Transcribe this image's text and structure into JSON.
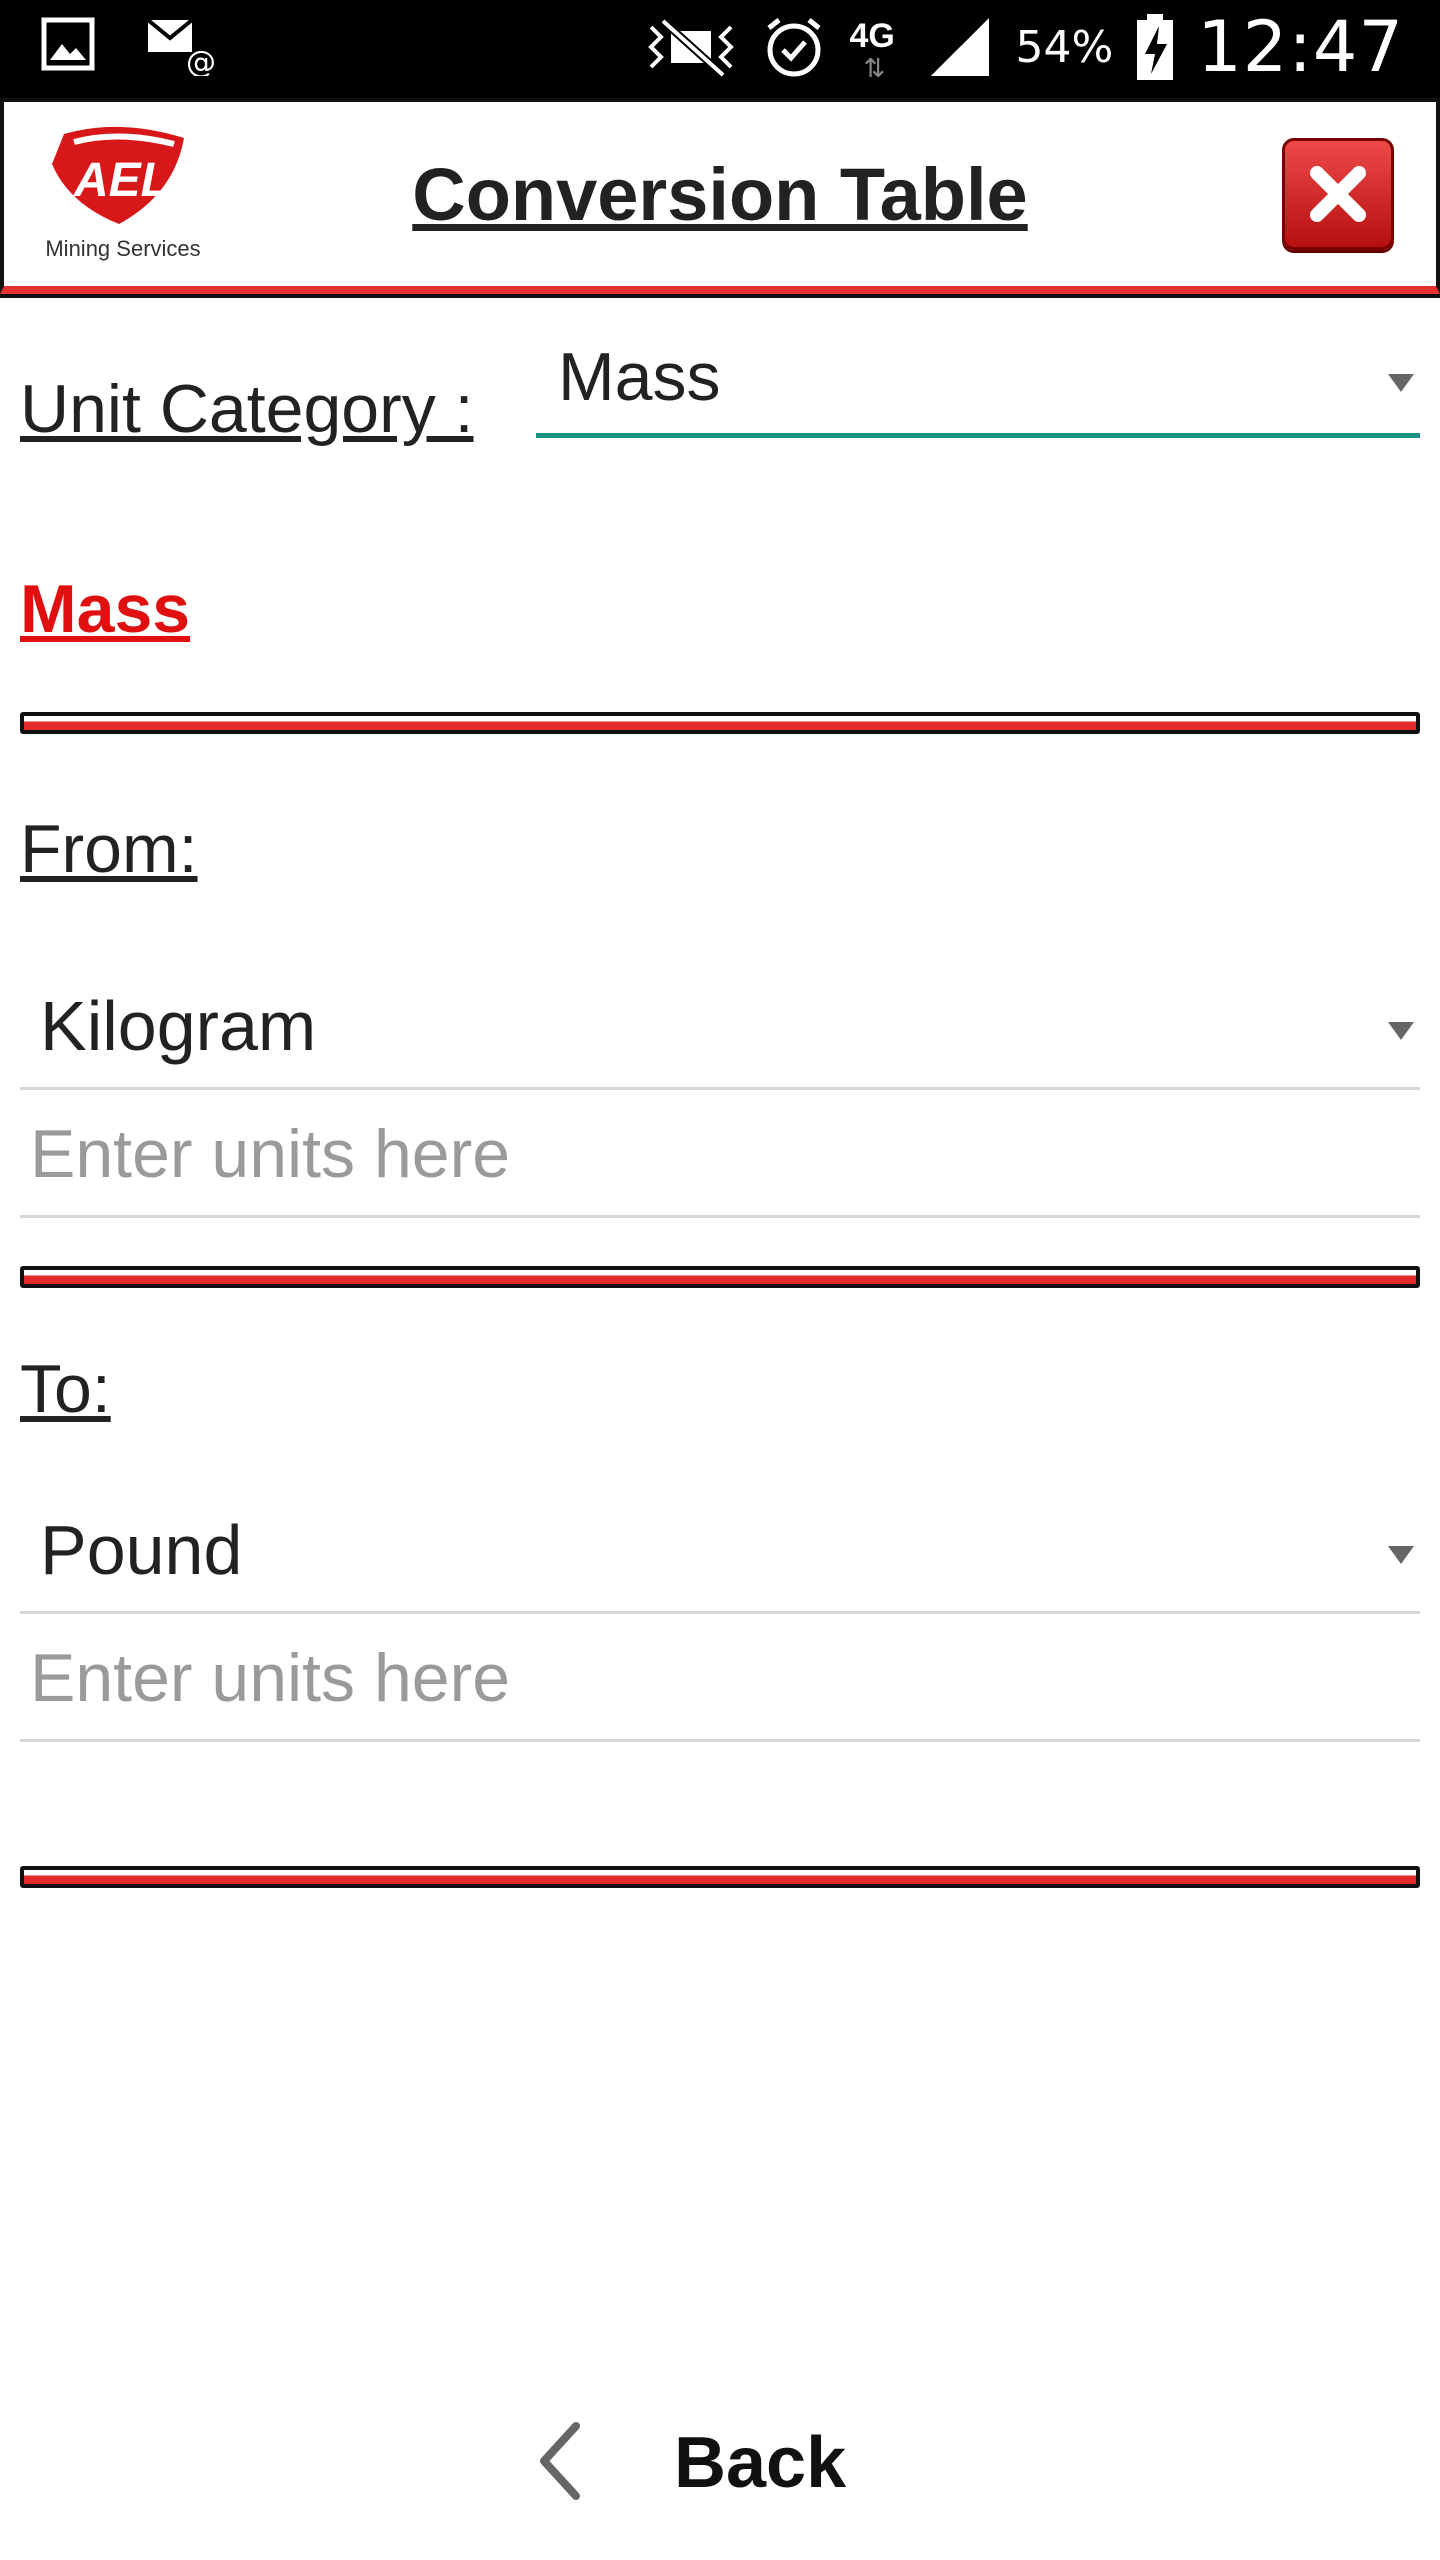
{
  "status_bar": {
    "network": "4G",
    "battery": "54%",
    "time": "12:47",
    "icons": [
      "gallery-icon",
      "email-icon",
      "mute-icon",
      "alarm-icon",
      "network-4g-icon",
      "signal-icon",
      "battery-charging-icon"
    ]
  },
  "header": {
    "logo_text": "AEL",
    "logo_caption": "Mining Services",
    "title": "Conversion Table",
    "close_icon": "close-icon"
  },
  "category": {
    "label": "Unit Category :",
    "selected": "Mass"
  },
  "section_title": "Mass",
  "from": {
    "label": "From:",
    "unit": "Kilogram",
    "input_placeholder": "Enter units here",
    "input_value": ""
  },
  "to": {
    "label": "To:",
    "unit": "Pound",
    "input_placeholder": "Enter units here",
    "input_value": ""
  },
  "footer": {
    "back_label": "Back",
    "back_icon": "chevron-left-icon"
  },
  "colors": {
    "accent_red": "#e01010",
    "underline_teal": "#1a9385",
    "status_bar": "#000000"
  }
}
